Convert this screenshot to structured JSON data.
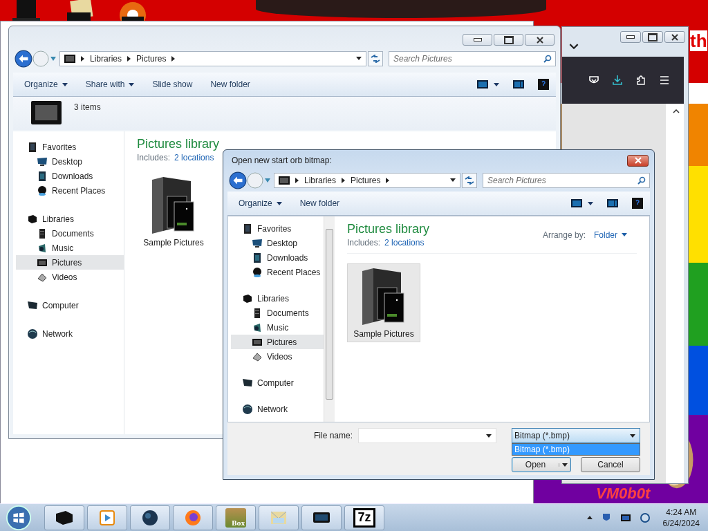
{
  "desktop": {
    "wallpaper_texts": [
      "th",
      "VM0b0t"
    ]
  },
  "explorer": {
    "breadcrumbs": [
      "Libraries",
      "Pictures"
    ],
    "search": {
      "placeholder": "Search Pictures"
    },
    "toolbar": [
      {
        "label": "Organize",
        "menu": true
      },
      {
        "label": "Share with",
        "menu": true
      },
      {
        "label": "Slide show",
        "menu": false
      },
      {
        "label": "New folder",
        "menu": false
      }
    ],
    "details": {
      "count": "3 items"
    },
    "nav": [
      {
        "label": "Favorites",
        "kind": "favorites",
        "selected": false,
        "children": [
          {
            "label": "Desktop",
            "kind": "desktop",
            "selected": false
          },
          {
            "label": "Downloads",
            "kind": "downloads",
            "selected": false
          },
          {
            "label": "Recent Places",
            "kind": "recent",
            "selected": false
          }
        ]
      },
      {
        "label": "Libraries",
        "kind": "libraries",
        "selected": false,
        "children": [
          {
            "label": "Documents",
            "kind": "documents",
            "selected": false
          },
          {
            "label": "Music",
            "kind": "music",
            "selected": false
          },
          {
            "label": "Pictures",
            "kind": "pictures",
            "selected": true
          },
          {
            "label": "Videos",
            "kind": "videos",
            "selected": false
          }
        ]
      },
      {
        "label": "Computer",
        "kind": "computer",
        "selected": false
      },
      {
        "label": "Network",
        "kind": "network",
        "selected": false
      }
    ],
    "library": {
      "title": "Pictures library",
      "includes": "Includes:",
      "locations": "2 locations"
    },
    "items": [
      {
        "label": "Sample Pictures",
        "selected": false
      }
    ]
  },
  "dialog": {
    "title": "Open new start orb bitmap:",
    "breadcrumbs": [
      "Libraries",
      "Pictures"
    ],
    "search": {
      "placeholder": "Search Pictures"
    },
    "toolbar": [
      {
        "label": "Organize",
        "menu": true
      },
      {
        "label": "New folder",
        "menu": false
      }
    ],
    "nav": [
      {
        "label": "Favorites",
        "kind": "favorites",
        "selected": false,
        "children": [
          {
            "label": "Desktop",
            "kind": "desktop",
            "selected": false
          },
          {
            "label": "Downloads",
            "kind": "downloads",
            "selected": false
          },
          {
            "label": "Recent Places",
            "kind": "recent",
            "selected": false
          }
        ]
      },
      {
        "label": "Libraries",
        "kind": "libraries",
        "selected": false,
        "children": [
          {
            "label": "Documents",
            "kind": "documents",
            "selected": false
          },
          {
            "label": "Music",
            "kind": "music",
            "selected": false
          },
          {
            "label": "Pictures",
            "kind": "pictures",
            "selected": true
          },
          {
            "label": "Videos",
            "kind": "videos",
            "selected": false
          }
        ]
      },
      {
        "label": "Computer",
        "kind": "computer",
        "selected": false
      },
      {
        "label": "Network",
        "kind": "network",
        "selected": false
      }
    ],
    "library": {
      "title": "Pictures library",
      "includes": "Includes:",
      "locations": "2 locations"
    },
    "arrange": {
      "label": "Arrange by:",
      "value": "Folder"
    },
    "items": [
      {
        "label": "Sample Pictures",
        "selected": true
      }
    ],
    "file_name": {
      "label": "File name:"
    },
    "filter": {
      "value": "Bitmap (*.bmp)",
      "expanded": true,
      "options": [
        {
          "label": "Bitmap (*.bmp)",
          "selected": true
        }
      ]
    },
    "buttons": [
      {
        "label": "Open",
        "kind": "split"
      },
      {
        "label": "Cancel",
        "kind": "plain"
      }
    ]
  },
  "taskbar": {
    "buttons": [
      {
        "kind": "explorer"
      },
      {
        "kind": "media"
      },
      {
        "kind": "globe"
      },
      {
        "kind": "firefox"
      },
      {
        "kind": "box",
        "label": "Box"
      },
      {
        "kind": "mail"
      },
      {
        "kind": "monitor"
      },
      {
        "kind": "archive",
        "label": "7z"
      }
    ],
    "clock": {
      "time": "4:24 AM",
      "date": "6/24/2024"
    }
  }
}
